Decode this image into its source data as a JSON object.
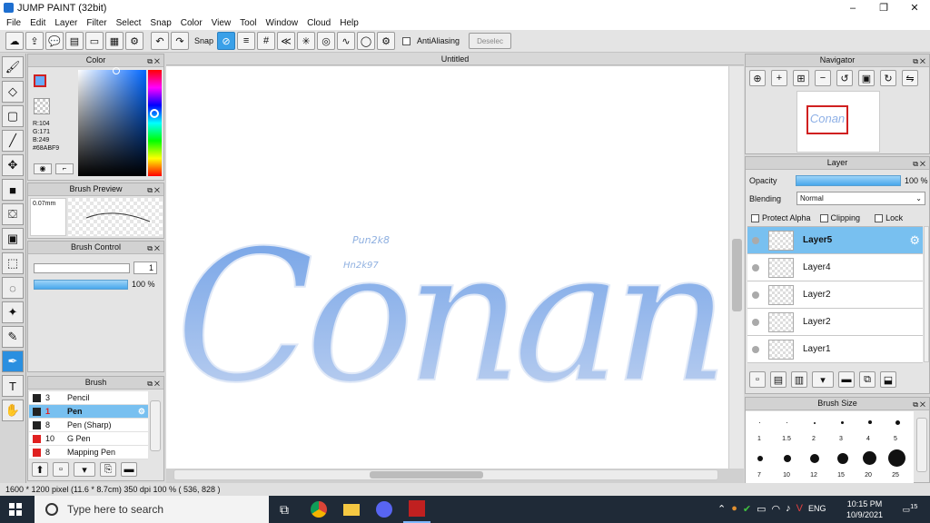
{
  "window": {
    "title": "JUMP PAINT (32bit)",
    "min": "–",
    "max": "❐",
    "close": "✕"
  },
  "menu": [
    "File",
    "Edit",
    "Layer",
    "Filter",
    "Select",
    "Snap",
    "Color",
    "View",
    "Tool",
    "Window",
    "Cloud",
    "Help"
  ],
  "toolbar": {
    "snap_label": "Snap",
    "antialiasing_label": "AntiAliasing",
    "deselect_label": "Deselec"
  },
  "canvas": {
    "tab_title": "Untitled",
    "artwork_text": "Conan",
    "note1": "Pun2k8",
    "note2": "Hn2k97"
  },
  "color_panel": {
    "title": "Color",
    "r": "R:104",
    "g": "G:171",
    "b": "B:249",
    "hex": "#68ABF9",
    "fg_color": "#68abf9"
  },
  "brush_preview": {
    "title": "Brush Preview",
    "size": "0.07mm"
  },
  "brush_control": {
    "title": "Brush Control",
    "size_value": "1",
    "opacity_value": "100 %"
  },
  "brush_panel": {
    "title": "Brush",
    "items": [
      {
        "num": "3",
        "name": "Pencil",
        "color": "#222222"
      },
      {
        "num": "1",
        "name": "Pen",
        "color": "#222222"
      },
      {
        "num": "8",
        "name": "Pen (Sharp)",
        "color": "#222222"
      },
      {
        "num": "10",
        "name": "G Pen",
        "color": "#e02020"
      },
      {
        "num": "8",
        "name": "Mapping Pen",
        "color": "#e02020"
      }
    ]
  },
  "navigator": {
    "title": "Navigator",
    "thumb_text": "Conan"
  },
  "layer_panel": {
    "title": "Layer",
    "opacity_label": "Opacity",
    "opacity_value": "100 %",
    "blending_label": "Blending",
    "blending_value": "Normal",
    "protect_alpha": "Protect Alpha",
    "clipping": "Clipping",
    "lock": "Lock",
    "layers": [
      "Layer5",
      "Layer4",
      "Layer2",
      "Layer2",
      "Layer1"
    ]
  },
  "brush_size": {
    "title": "Brush Size",
    "row1": [
      "1",
      "1.5",
      "2",
      "3",
      "4",
      "5"
    ],
    "row2": [
      "7",
      "10",
      "12",
      "15",
      "20",
      "25"
    ]
  },
  "status": {
    "text": "1600 * 1200 pixel   (11.6 * 8.7cm)   350 dpi   100 %   ( 536, 828 )"
  },
  "taskbar": {
    "search_placeholder": "Type here to search",
    "lang": "ENG",
    "time": "10:15 PM",
    "date": "10/9/2021",
    "notif": "15"
  }
}
